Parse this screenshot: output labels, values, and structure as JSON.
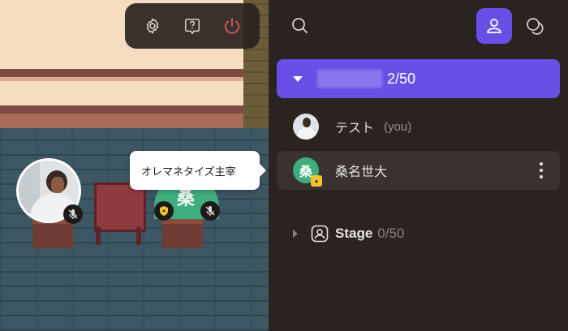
{
  "toolbar": {
    "buttons": [
      {
        "icon": "gear-icon"
      },
      {
        "icon": "help-icon"
      },
      {
        "icon": "power-icon"
      }
    ]
  },
  "scene": {
    "tooltip": "オレマネタイズ主宰",
    "green_avatar_initial": "桑"
  },
  "panel": {
    "tabs": [
      {
        "icon": "search-icon"
      },
      {
        "icon": "people-icon",
        "active": true
      },
      {
        "icon": "chat-icon"
      }
    ],
    "group": {
      "count": "2/50",
      "expanded": true
    },
    "members": [
      {
        "name": "テスト",
        "suffix": "(you)",
        "avatar": "photo"
      },
      {
        "name": "桑名世大",
        "initial": "桑",
        "avatar": "green",
        "moderator": true
      }
    ],
    "stage": {
      "label": "Stage",
      "count": "0/50"
    }
  },
  "colors": {
    "accent": "#6a4fe6",
    "panel_bg": "#2b2320",
    "power": "#e05a5a",
    "moderator_badge": "#f2c230",
    "green_avatar": "#3fae7e"
  }
}
